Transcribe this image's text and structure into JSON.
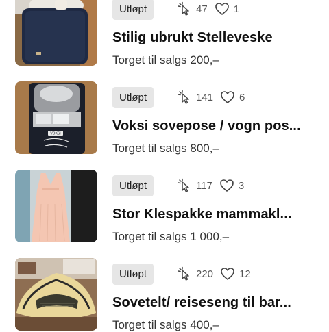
{
  "listings": [
    {
      "status": "Utløpt",
      "clicks": "47",
      "favorites": "1",
      "title": "Stilig ubrukt Stelleveske",
      "price": "Torget til salgs 200,–",
      "image": "bag-photo"
    },
    {
      "status": "Utløpt",
      "clicks": "141",
      "favorites": "6",
      "title": "Voksi sovepose / vogn pos...",
      "price": "Torget til salgs 800,–",
      "image": "sleeping-bag-photo",
      "image_text": "VOKSI"
    },
    {
      "status": "Utløpt",
      "clicks": "117",
      "favorites": "3",
      "title": "Stor Klespakke mammakl...",
      "price": "Torget til salgs 1 000,–",
      "image": "dress-photo"
    },
    {
      "status": "Utløpt",
      "clicks": "220",
      "favorites": "12",
      "title": "Sovetelt/ reiseseng til bar...",
      "price": "Torget til salgs 400,–",
      "image": "travel-tent-photo"
    }
  ],
  "icons": {
    "clicks": "cursor-click-icon",
    "favorites": "heart-outline-icon"
  },
  "colors": {
    "badge_bg": "#e6e6e6",
    "text": "#111111",
    "meta": "#555555"
  }
}
